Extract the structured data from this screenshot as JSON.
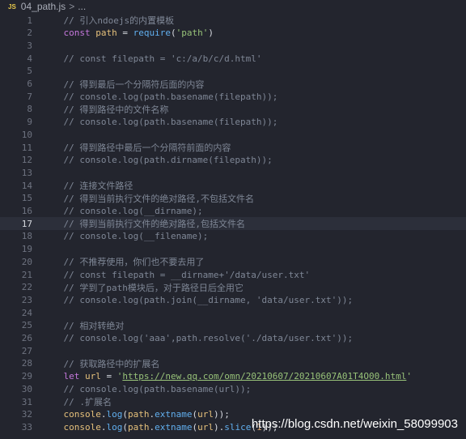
{
  "breadcrumb": {
    "file_icon": "JS",
    "file_name": "04_path.js",
    "separator": ">",
    "rest": "..."
  },
  "editor": {
    "active_line": 17,
    "lines": [
      {
        "n": "1",
        "text": "    // 引入ndoejs的内置模板"
      },
      {
        "n": "2",
        "text": "    const path = require('path')"
      },
      {
        "n": "3",
        "text": ""
      },
      {
        "n": "4",
        "text": "    // const filepath = 'c:/a/b/c/d.html'"
      },
      {
        "n": "5",
        "text": ""
      },
      {
        "n": "6",
        "text": "    // 得到最后一个分隔符后面的内容"
      },
      {
        "n": "7",
        "text": "    // console.log(path.basename(filepath));"
      },
      {
        "n": "8",
        "text": "    // 得到路径中的文件名称"
      },
      {
        "n": "9",
        "text": "    // console.log(path.basename(filepath));"
      },
      {
        "n": "10",
        "text": ""
      },
      {
        "n": "11",
        "text": "    // 得到路径中最后一个分隔符前面的内容"
      },
      {
        "n": "12",
        "text": "    // console.log(path.dirname(filepath));"
      },
      {
        "n": "13",
        "text": ""
      },
      {
        "n": "14",
        "text": "    // 连接文件路径"
      },
      {
        "n": "15",
        "text": "    // 得到当前执行文件的绝对路径,不包括文件名"
      },
      {
        "n": "16",
        "text": "    // console.log(__dirname);"
      },
      {
        "n": "17",
        "text": "    // 得到当前执行文件的绝对路径,包括文件名"
      },
      {
        "n": "18",
        "text": "    // console.log(__filename);"
      },
      {
        "n": "19",
        "text": ""
      },
      {
        "n": "20",
        "text": "    // 不推荐使用，你们也不要去用了"
      },
      {
        "n": "21",
        "text": "    // const filepath = __dirname+'/data/user.txt'"
      },
      {
        "n": "22",
        "text": "    // 学到了path模块后，对于路径日后全用它"
      },
      {
        "n": "23",
        "text": "    // console.log(path.join(__dirname, 'data/user.txt'));"
      },
      {
        "n": "24",
        "text": ""
      },
      {
        "n": "25",
        "text": "    // 相对转绝对"
      },
      {
        "n": "26",
        "text": "    // console.log('aaa',path.resolve('./data/user.txt'));"
      },
      {
        "n": "27",
        "text": ""
      },
      {
        "n": "28",
        "text": "    // 获取路径中的扩展名"
      },
      {
        "n": "29",
        "text": "    let url = 'https://new.qq.com/omn/20210607/20210607A01T4O00.html'"
      },
      {
        "n": "30",
        "text": "    // console.log(path.basename(url));"
      },
      {
        "n": "31",
        "text": "    // .扩展名"
      },
      {
        "n": "32",
        "text": "    console.log(path.extname(url));"
      },
      {
        "n": "33",
        "text": "    console.log(path.extname(url).slice(1));"
      }
    ]
  },
  "watermark": "https://blog.csdn.net/weixin_58099903",
  "colors": {
    "background": "#23252e",
    "comment": "#7f8796",
    "keyword": "#c678dd",
    "variable": "#e5c07b",
    "string": "#98c379",
    "function": "#61afef",
    "number": "#d19a66"
  }
}
